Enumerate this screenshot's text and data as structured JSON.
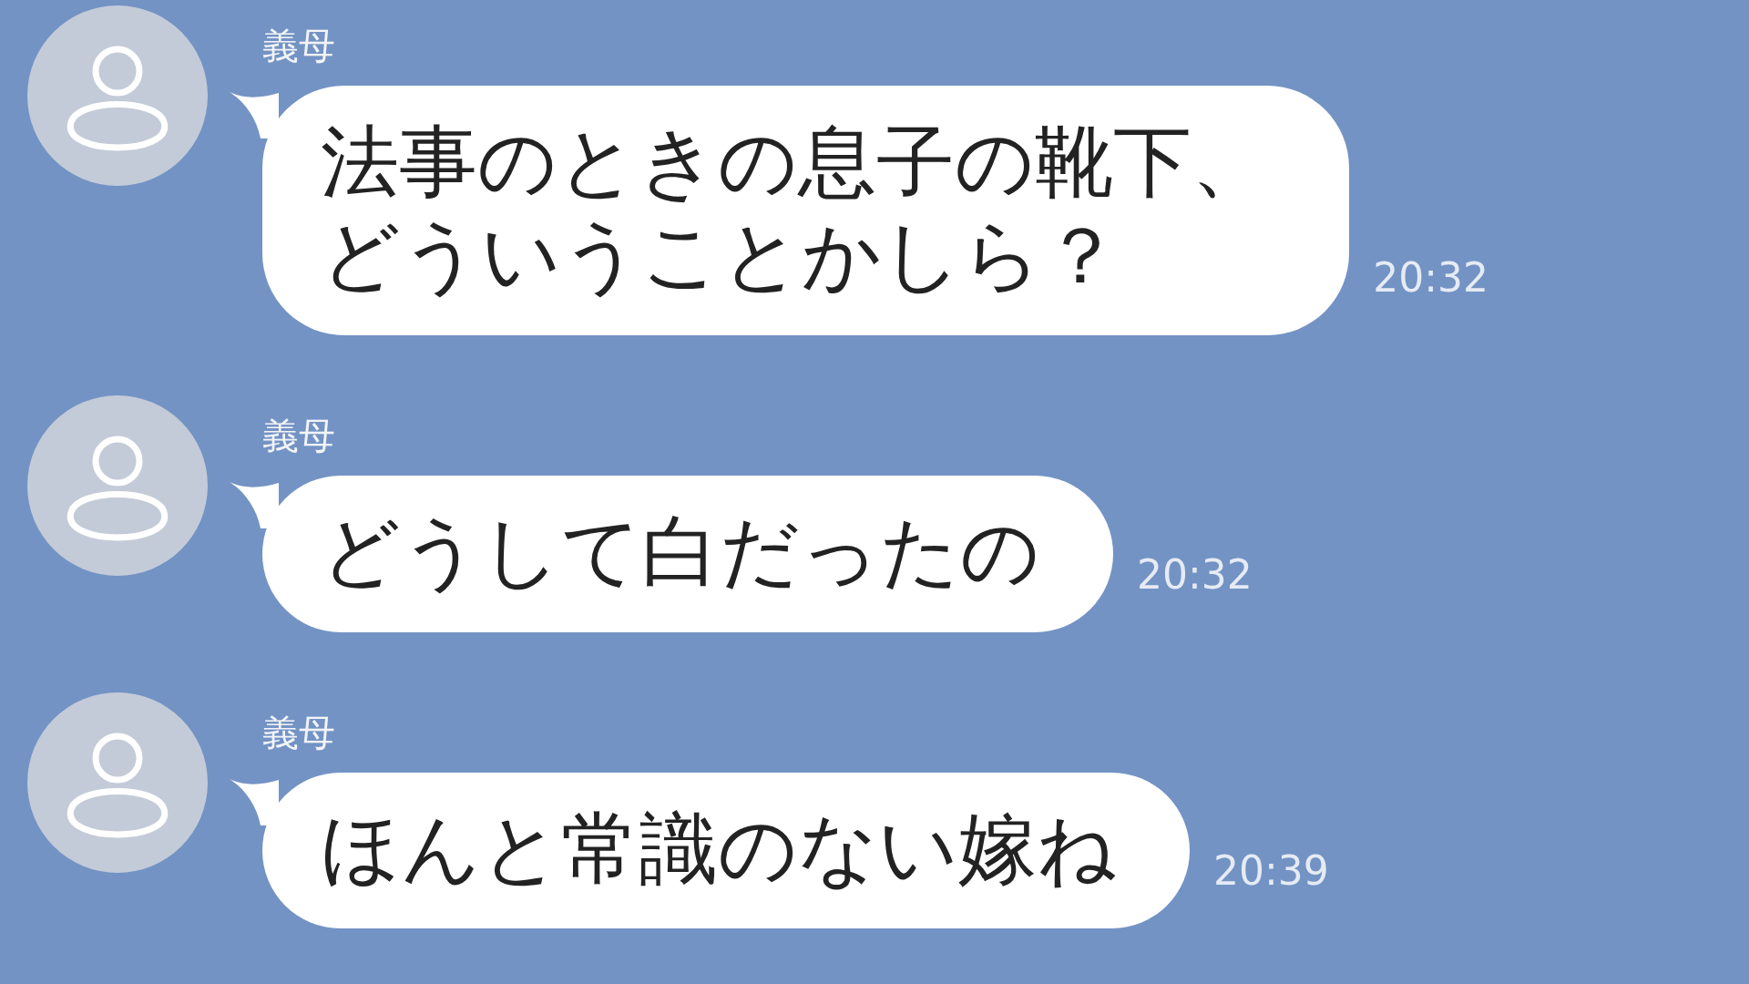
{
  "messages": [
    {
      "sender": "義母",
      "text": "法事のときの息子の靴下、どういうことかしら？",
      "time": "20:32"
    },
    {
      "sender": "義母",
      "text": "どうして白だったの",
      "time": "20:32"
    },
    {
      "sender": "義母",
      "text": "ほんと常識のない嫁ね",
      "time": "20:39"
    }
  ]
}
